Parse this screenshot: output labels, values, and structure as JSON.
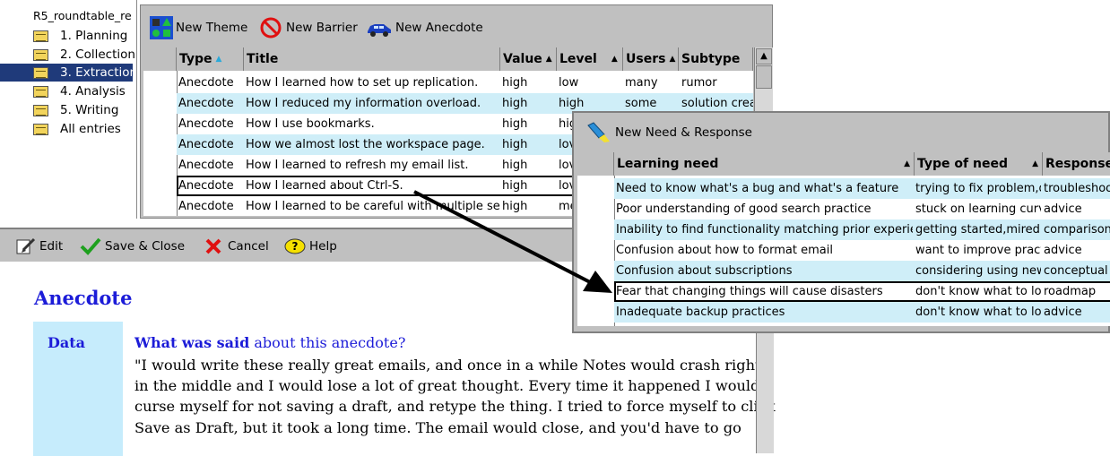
{
  "navigator": {
    "title": "R5_roundtable_re",
    "items": [
      {
        "label": "1. Planning",
        "selected": false
      },
      {
        "label": "2. Collection",
        "selected": false
      },
      {
        "label": "3. Extraction",
        "selected": true
      },
      {
        "label": "4. Analysis",
        "selected": false
      },
      {
        "label": "5. Writing",
        "selected": false
      },
      {
        "label": "All entries",
        "selected": false
      }
    ]
  },
  "top_view": {
    "toolbar": {
      "new_theme": "New Theme",
      "new_barrier": "New Barrier",
      "new_anecdote": "New Anecdote"
    },
    "columns": [
      "Type",
      "Title",
      "Value",
      "Level",
      "Users",
      "Subtype"
    ],
    "rows": [
      [
        "Anecdote",
        "How I learned how to set up replication.",
        "high",
        "low",
        "many",
        "rumor"
      ],
      [
        "Anecdote",
        "How I reduced my information overload.",
        "high",
        "high",
        "some",
        "solution creat"
      ],
      [
        "Anecdote",
        "How I use bookmarks.",
        "high",
        "hig",
        "",
        ""
      ],
      [
        "Anecdote",
        "How we almost lost the workspace page.",
        "high",
        "lov",
        "",
        ""
      ],
      [
        "Anecdote",
        "How I learned to refresh my email list.",
        "high",
        "lov",
        "",
        ""
      ],
      [
        "Anecdote",
        "How I learned about Ctrl-S.",
        "high",
        "lov",
        "",
        ""
      ],
      [
        "Anecdote",
        "How I learned to be careful with multiple selec",
        "high",
        "me",
        "",
        ""
      ]
    ]
  },
  "doc": {
    "toolbar": {
      "edit": "Edit",
      "save_close": "Save & Close",
      "cancel": "Cancel",
      "help": "Help"
    },
    "title": "Anecdote",
    "data_label": "Data",
    "question_bold": "What was said",
    "question_rest": " about this anecdote?",
    "quote_lines": [
      "\"I would write these really great emails, and once in a while Notes would crash right",
      "in the middle and I would lose a lot of great thought. Every time it happened I would",
      "curse myself for not saving a draft, and retype the thing. I tried to force myself to click",
      "Save as Draft, but it took a long time. The email would close, and you'd have to go"
    ]
  },
  "need_view": {
    "toolbar": {
      "new_need": "New Need & Response"
    },
    "columns": [
      "Learning need",
      "Type of need",
      "Response"
    ],
    "rows": [
      [
        "Need to know what's a bug and what's a feature",
        "trying to fix problem,dor",
        "troubleshoo"
      ],
      [
        "Poor understanding of good search practice",
        "stuck on learning curve",
        "advice"
      ],
      [
        "Inability to find functionality matching prior experience",
        "getting started,mired in",
        "comparison"
      ],
      [
        "Confusion about how to format email",
        "want to improve practic",
        "advice"
      ],
      [
        "Confusion about subscriptions",
        "considering using new",
        "conceptual"
      ],
      [
        "Fear that changing things will cause disasters",
        "don't know what to loo",
        "roadmap"
      ],
      [
        "Inadequate backup practices",
        "don't know what to loo",
        "advice"
      ]
    ]
  },
  "colors": {
    "row_highlight": "#cfeef8",
    "selected_nav": "#1f3a7a",
    "heading_blue": "#1c1cd8",
    "data_box": "#c6ecfc",
    "chrome_gray": "#c0c0c0"
  }
}
